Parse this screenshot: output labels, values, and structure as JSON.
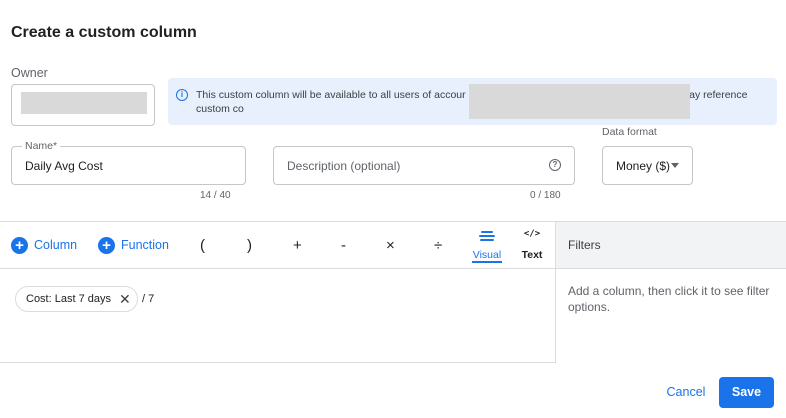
{
  "dialog": {
    "title": "Create a custom column"
  },
  "owner": {
    "label": "Owner"
  },
  "info": {
    "text": "This custom column will be available to all users of accour                                              unts. When creating this custom column, you may reference custom co"
  },
  "name": {
    "label": "Name*",
    "value": "Daily Avg Cost",
    "counter": "14 / 40"
  },
  "description": {
    "placeholder": "Description (optional)",
    "counter": "0 / 180"
  },
  "data_format": {
    "label": "Data format",
    "value": "Money ($)"
  },
  "toolbar": {
    "column_label": "Column",
    "function_label": "Function",
    "operators": {
      "open_paren": "(",
      "close_paren": ")",
      "plus": "+",
      "minus": "-",
      "multiply": "×",
      "divide": "÷"
    },
    "visual_label": "Visual",
    "text_label": "Text",
    "text_icon": "</>"
  },
  "formula": {
    "chip_label": "Cost: Last 7 days",
    "rest": "/ 7"
  },
  "filters": {
    "title": "Filters",
    "hint": "Add a column, then click it to see filter options."
  },
  "actions": {
    "cancel": "Cancel",
    "save": "Save"
  },
  "colors": {
    "accent": "#1a73e8",
    "banner": "#e8f0fe",
    "panel_header": "#f1f3f4"
  }
}
